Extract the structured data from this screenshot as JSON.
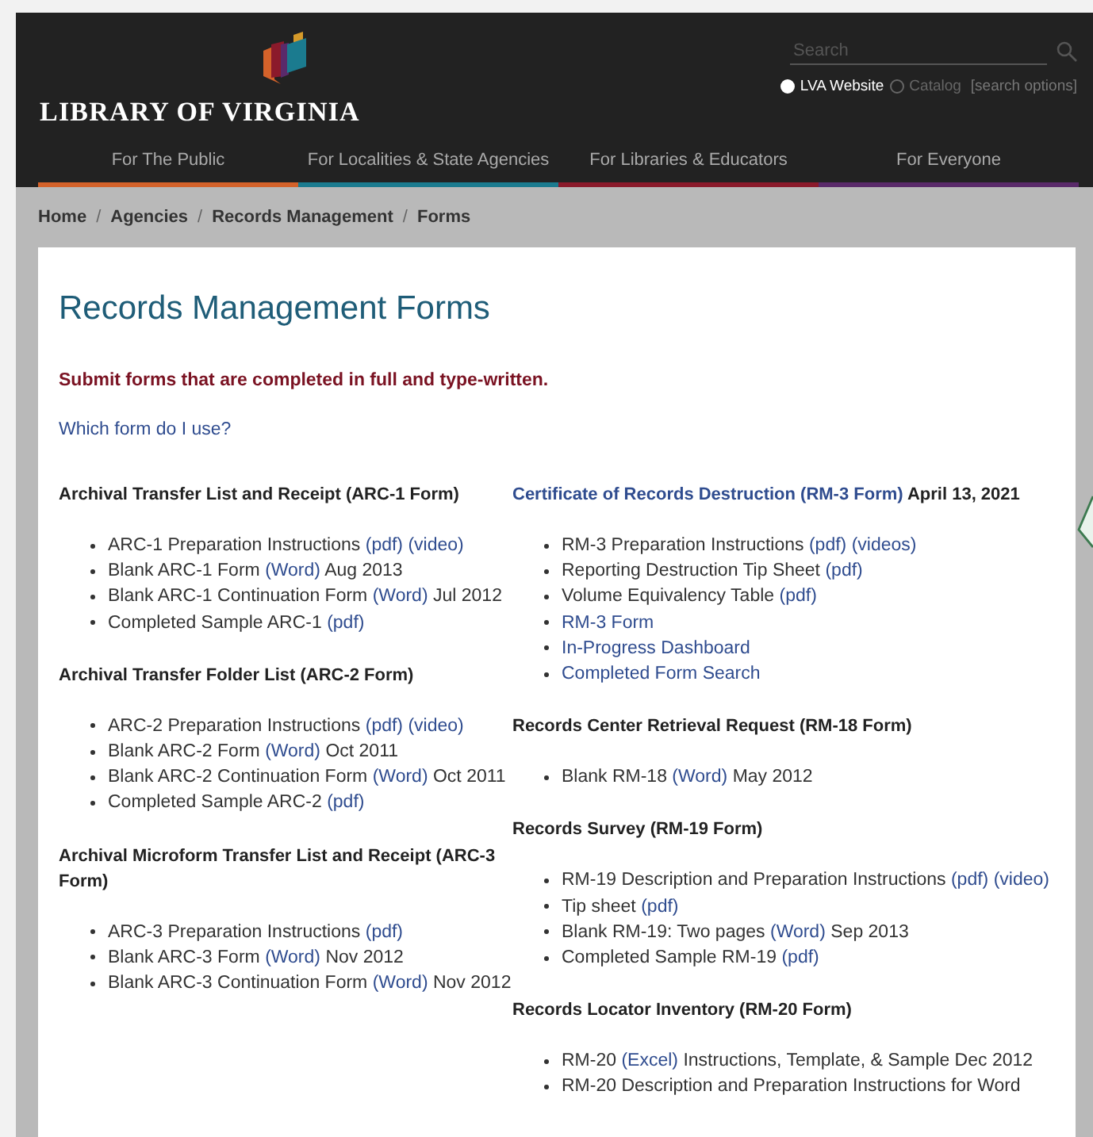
{
  "header": {
    "logo_text": "LIBRARY OF VIRGINIA",
    "search": {
      "placeholder": "Search"
    },
    "scopes": [
      {
        "label": "LVA Website",
        "selected": true
      },
      {
        "label": "Catalog",
        "selected": false
      }
    ],
    "search_options": "[search options]",
    "nav": [
      {
        "label": "For The Public",
        "color": "#d4622a"
      },
      {
        "label": "For Localities & State Agencies",
        "color": "#1b7b8f"
      },
      {
        "label": "For Libraries & Educators",
        "color": "#8b1a2b"
      },
      {
        "label": "For Everyone",
        "color": "#5a2a6a"
      }
    ]
  },
  "breadcrumb": {
    "separator": "/",
    "items": [
      "Home",
      "Agencies",
      "Records Management",
      "Forms"
    ]
  },
  "main": {
    "title": "Records Management Forms",
    "notice": "Submit forms that are completed in full and type-written.",
    "help_link": "Which form do I use?",
    "columns": [
      [
        {
          "heading": [
            {
              "text": "Archival Transfer List and Receipt (ARC-1 Form)",
              "link": false
            }
          ],
          "items": [
            [
              {
                "text": "ARC-1 Preparation Instructions",
                "link": false
              },
              {
                "text": "(pdf)",
                "link": true
              },
              {
                "text": "(video)",
                "link": true
              }
            ],
            [
              {
                "text": "Blank ARC-1 Form",
                "link": false
              },
              {
                "text": "(Word)",
                "link": true
              },
              {
                "text": "Aug 2013",
                "link": false
              }
            ],
            [
              {
                "text": "Blank ARC-1 Continuation Form",
                "link": false
              },
              {
                "text": "(Word)",
                "link": true
              },
              {
                "text": "Jul 2012",
                "link": false
              }
            ],
            [
              {
                "text": "Completed Sample ARC-1",
                "link": false
              },
              {
                "text": "(pdf)",
                "link": true
              }
            ]
          ]
        },
        {
          "heading": [
            {
              "text": "Archival Transfer Folder List (ARC-2 Form)",
              "link": false
            }
          ],
          "items": [
            [
              {
                "text": "ARC-2 Preparation Instructions",
                "link": false
              },
              {
                "text": "(pdf)",
                "link": true
              },
              {
                "text": "(video)",
                "link": true
              }
            ],
            [
              {
                "text": "Blank ARC-2 Form",
                "link": false
              },
              {
                "text": "(Word)",
                "link": true
              },
              {
                "text": "Oct 2011",
                "link": false
              }
            ],
            [
              {
                "text": "Blank ARC-2 Continuation Form",
                "link": false
              },
              {
                "text": "(Word)",
                "link": true
              },
              {
                "text": "Oct 2011",
                "link": false
              }
            ],
            [
              {
                "text": "Completed Sample ARC-2",
                "link": false
              },
              {
                "text": "(pdf)",
                "link": true
              }
            ]
          ]
        },
        {
          "heading": [
            {
              "text": "Archival Microform Transfer List and Receipt (ARC-3 Form)",
              "link": false
            }
          ],
          "items": [
            [
              {
                "text": "ARC-3 Preparation Instructions",
                "link": false
              },
              {
                "text": "(pdf)",
                "link": true
              }
            ],
            [
              {
                "text": "Blank ARC-3 Form",
                "link": false
              },
              {
                "text": "(Word)",
                "link": true
              },
              {
                "text": "Nov 2012",
                "link": false
              }
            ],
            [
              {
                "text": "Blank ARC-3 Continuation Form",
                "link": false
              },
              {
                "text": "(Word)",
                "link": true
              },
              {
                "text": "Nov 2012",
                "link": false
              }
            ]
          ]
        }
      ],
      [
        {
          "heading": [
            {
              "text": "Certificate of Records Destruction (RM-3 Form)",
              "link": true
            },
            {
              "text": "April 13, 2021",
              "link": false
            }
          ],
          "items": [
            [
              {
                "text": "RM-3 Preparation Instructions",
                "link": false
              },
              {
                "text": "(pdf)",
                "link": true
              },
              {
                "text": "(videos)",
                "link": true
              }
            ],
            [
              {
                "text": "Reporting Destruction Tip Sheet",
                "link": false
              },
              {
                "text": "(pdf)",
                "link": true
              }
            ],
            [
              {
                "text": "Volume Equivalency Table",
                "link": false
              },
              {
                "text": "(pdf)",
                "link": true
              }
            ],
            [
              {
                "text": "RM-3 Form",
                "link": true
              }
            ],
            [
              {
                "text": "In-Progress Dashboard",
                "link": true
              }
            ],
            [
              {
                "text": "Completed Form Search",
                "link": true
              }
            ]
          ]
        },
        {
          "heading": [
            {
              "text": "Records Center Retrieval Request (RM-18 Form)",
              "link": false
            }
          ],
          "items": [
            [
              {
                "text": "Blank RM-18",
                "link": false
              },
              {
                "text": "(Word)",
                "link": true
              },
              {
                "text": "May 2012",
                "link": false
              }
            ]
          ]
        },
        {
          "heading": [
            {
              "text": "Records Survey (RM-19 Form)",
              "link": false
            }
          ],
          "items": [
            [
              {
                "text": "RM-19 Description and Preparation Instructions",
                "link": false
              },
              {
                "text": "(pdf)",
                "link": true
              },
              {
                "text": "(video)",
                "link": true
              }
            ],
            [
              {
                "text": "Tip sheet",
                "link": false
              },
              {
                "text": "(pdf)",
                "link": true
              }
            ],
            [
              {
                "text": "Blank RM-19: Two pages",
                "link": false
              },
              {
                "text": "(Word)",
                "link": true
              },
              {
                "text": "Sep 2013",
                "link": false
              }
            ],
            [
              {
                "text": "Completed Sample RM-19",
                "link": false
              },
              {
                "text": "(pdf)",
                "link": true
              }
            ]
          ]
        },
        {
          "heading": [
            {
              "text": "Records Locator Inventory (RM-20 Form)",
              "link": false
            }
          ],
          "items": [
            [
              {
                "text": "RM-20",
                "link": false
              },
              {
                "text": "(Excel)",
                "link": true
              },
              {
                "text": "Instructions, Template, & Sample Dec 2012",
                "link": false
              }
            ],
            [
              {
                "text": "RM-20 Description and Preparation Instructions for Word",
                "link": false
              }
            ]
          ]
        }
      ]
    ]
  }
}
